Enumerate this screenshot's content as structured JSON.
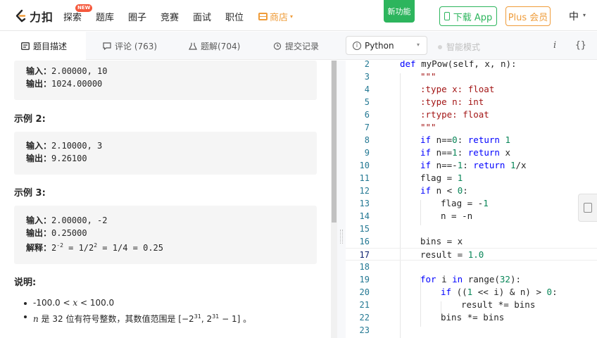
{
  "nav": {
    "logo_text": "力扣",
    "items": [
      "探索",
      "题库",
      "圈子",
      "竞赛",
      "面试",
      "职位"
    ],
    "new_badge": "NEW",
    "shop": "商店",
    "new_feature": "新功能",
    "download_app": "下载 App",
    "plus": "Plus 会员",
    "lang": "中"
  },
  "tabs": {
    "description": "题目描述",
    "comments": "评论 (763)",
    "solutions": "题解(704)",
    "submissions": "提交记录"
  },
  "editor_toolbar": {
    "language": "Python",
    "smart_mode": "智能模式",
    "info_button": "i",
    "format_button": "{}"
  },
  "description": {
    "example1": {
      "input_label": "输入：",
      "input_value": "2.00000, 10",
      "output_label": "输出：",
      "output_value": "1024.00000"
    },
    "example2": {
      "title": "示例 2:",
      "input_label": "输入：",
      "input_value": "2.10000, 3",
      "output_label": "输出：",
      "output_value": "9.26100"
    },
    "example3": {
      "title": "示例 3:",
      "input_label": "输入：",
      "input_value": "2.00000, -2",
      "output_label": "输出：",
      "output_value": "0.25000",
      "explain_label": "解释：",
      "explain_base": "2",
      "explain_exp": "-2",
      "explain_mid": " = 1/2",
      "explain_exp2": "2",
      "explain_tail": " = 1/4 = 0.25"
    },
    "notes_title": "说明:",
    "note1": {
      "left": "-100.0 < ",
      "var": "x",
      "right": " < 100.0"
    },
    "note2": {
      "var": "n",
      "text": " 是 32 位有符号整数，其数值范围是 [−2",
      "exp1": "31",
      "mid": ", 2",
      "exp2": "31",
      "tail": " − 1] 。"
    }
  },
  "code": {
    "current_line": 17,
    "lines": [
      {
        "n": "2",
        "html": "<span class=\"kw\">def</span> myPow(self, x, n):",
        "indent": 0
      },
      {
        "n": "3",
        "html": "<span class=\"str\">\"\"\"</span>",
        "indent": 1
      },
      {
        "n": "4",
        "html": "<span class=\"str\">:type x: float</span>",
        "indent": 1
      },
      {
        "n": "5",
        "html": "<span class=\"str\">:type n: int</span>",
        "indent": 1
      },
      {
        "n": "6",
        "html": "<span class=\"str\">:rtype: float</span>",
        "indent": 1
      },
      {
        "n": "7",
        "html": "<span class=\"str\">\"\"\"</span>",
        "indent": 1
      },
      {
        "n": "8",
        "html": "<span class=\"kw\">if</span> n==<span class=\"num\">0</span>: <span class=\"kw\">return</span> <span class=\"num\">1</span>",
        "indent": 1
      },
      {
        "n": "9",
        "html": "<span class=\"kw\">if</span> n==<span class=\"num\">1</span>: <span class=\"kw\">return</span> x",
        "indent": 1
      },
      {
        "n": "10",
        "html": "<span class=\"kw\">if</span> n==-<span class=\"num\">1</span>: <span class=\"kw\">return</span> <span class=\"num\">1</span>/x",
        "indent": 1
      },
      {
        "n": "11",
        "html": "flag = <span class=\"num\">1</span>",
        "indent": 1
      },
      {
        "n": "12",
        "html": "<span class=\"kw\">if</span> n &lt; <span class=\"num\">0</span>:",
        "indent": 1
      },
      {
        "n": "13",
        "html": "flag = -<span class=\"num\">1</span>",
        "indent": 2
      },
      {
        "n": "14",
        "html": "n = -n",
        "indent": 2
      },
      {
        "n": "15",
        "html": "",
        "indent": 1
      },
      {
        "n": "16",
        "html": "bins = x",
        "indent": 1
      },
      {
        "n": "17",
        "html": "result = <span class=\"num\">1.0</span>",
        "indent": 1
      },
      {
        "n": "18",
        "html": "",
        "indent": 1
      },
      {
        "n": "19",
        "html": "<span class=\"kw\">for</span> i <span class=\"kw\">in</span> range(<span class=\"num\">32</span>):",
        "indent": 1
      },
      {
        "n": "20",
        "html": "<span class=\"kw\">if</span> ((<span class=\"num\">1</span> &lt;&lt; i) &amp; n) &gt; <span class=\"num\">0</span>:",
        "indent": 2
      },
      {
        "n": "21",
        "html": "result *= bins",
        "indent": 3
      },
      {
        "n": "22",
        "html": "bins *= bins",
        "indent": 2
      },
      {
        "n": "23",
        "html": "",
        "indent": 1
      }
    ]
  }
}
